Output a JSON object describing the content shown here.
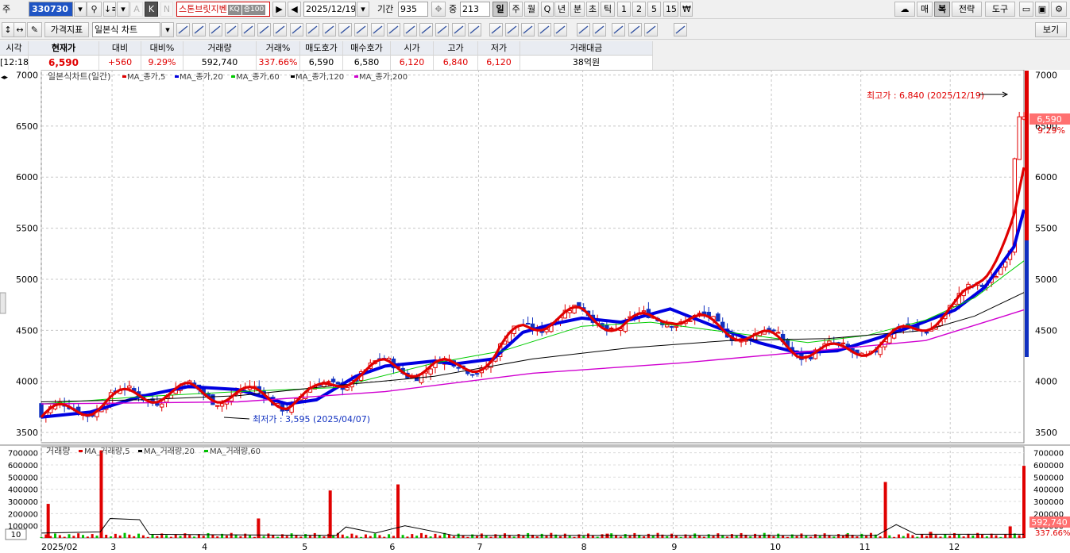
{
  "toolbar1": {
    "market": "주",
    "code": "330730",
    "name": "스톤브릿지벤",
    "name_tags": [
      "KQ",
      "증100"
    ],
    "k_button": "K",
    "n_button": "N",
    "date": "2025/12/19",
    "period_label": "기간",
    "period_value": "935",
    "mid_label": "중",
    "mid_value": "213",
    "timeframes": [
      "일",
      "주",
      "월",
      "Q",
      "년",
      "분",
      "초",
      "틱",
      "1",
      "2",
      "5",
      "15",
      "₩"
    ],
    "active_timeframe": "일",
    "right_buttons": [
      "매",
      "복",
      "전략",
      "도구"
    ]
  },
  "toolbar2": {
    "indicator_button": "가격지표",
    "chart_type": "일본식 차트",
    "view_button": "보기"
  },
  "quote": {
    "headers": [
      "시각",
      "현재가",
      "대비",
      "대비%",
      "거래량",
      "거래%",
      "매도호가",
      "매수호가",
      "시가",
      "고가",
      "저가",
      "거래대금"
    ],
    "values": [
      "[12:18]",
      "6,590",
      "+560",
      "9.29%",
      "592,740",
      "337.66%",
      "6,590",
      "6,580",
      "6,120",
      "6,840",
      "6,120",
      "38억원"
    ]
  },
  "colors": {
    "up": "#e00000",
    "ma5": "#e00000",
    "ma20": "#0000e0",
    "ma60": "#00cc00",
    "ma120": "#000000",
    "ma200": "#d000d0"
  },
  "price_legend": "일본식차트(일간)",
  "price_ma_labels": [
    "MA_종가,5",
    "MA_종가,20",
    "MA_종가,60",
    "MA_종가,120",
    "MA_종가,200"
  ],
  "volume_legend": "거래량",
  "volume_ma_labels": [
    "MA_거래량,5",
    "MA_거래량,20",
    "MA_거래량,60"
  ],
  "annotations": {
    "high": "최고가 : 6,840 (2025/12/19)",
    "low": "최저가 : 3,595 (2025/04/07)"
  },
  "current_price_tag": "6,590",
  "current_change_tag": "9.29%",
  "current_volume_tag": "592,740",
  "current_volume_pct_tag": "337.66%",
  "volume_scale_box": "10",
  "chart_data": [
    {
      "type": "candlestick",
      "title": "일본식차트(일간)",
      "ylim": [
        3400,
        7050
      ],
      "yticks": [
        3500,
        4000,
        4500,
        5000,
        5500,
        6000,
        6500,
        7000
      ],
      "x_months": [
        "2025/02",
        "3",
        "4",
        "5",
        "6",
        "7",
        "8",
        "9",
        "10",
        "11",
        "12"
      ],
      "ma": [
        {
          "name": "MA_종가,20",
          "points": [
            [
              0,
              3650
            ],
            [
              0.05,
              3700
            ],
            [
              0.1,
              3850
            ],
            [
              0.15,
              3950
            ],
            [
              0.2,
              3920
            ],
            [
              0.25,
              3780
            ],
            [
              0.28,
              3820
            ],
            [
              0.32,
              4050
            ],
            [
              0.35,
              4150
            ],
            [
              0.4,
              4200
            ],
            [
              0.42,
              4170
            ],
            [
              0.46,
              4220
            ],
            [
              0.49,
              4480
            ],
            [
              0.52,
              4560
            ],
            [
              0.55,
              4620
            ],
            [
              0.59,
              4580
            ],
            [
              0.64,
              4710
            ],
            [
              0.69,
              4520
            ],
            [
              0.73,
              4380
            ],
            [
              0.77,
              4280
            ],
            [
              0.81,
              4300
            ],
            [
              0.85,
              4420
            ],
            [
              0.89,
              4550
            ],
            [
              0.93,
              4700
            ],
            [
              0.96,
              4920
            ],
            [
              0.99,
              5320
            ],
            [
              1,
              5680
            ]
          ]
        },
        {
          "name": "MA_종가,60",
          "points": [
            [
              0,
              3780
            ],
            [
              0.1,
              3850
            ],
            [
              0.2,
              3900
            ],
            [
              0.3,
              3940
            ],
            [
              0.4,
              4180
            ],
            [
              0.47,
              4300
            ],
            [
              0.55,
              4540
            ],
            [
              0.62,
              4580
            ],
            [
              0.7,
              4480
            ],
            [
              0.78,
              4380
            ],
            [
              0.84,
              4450
            ],
            [
              0.9,
              4600
            ],
            [
              0.95,
              4820
            ],
            [
              1,
              5180
            ]
          ]
        },
        {
          "name": "MA_종가,120",
          "points": [
            [
              0,
              3800
            ],
            [
              0.1,
              3820
            ],
            [
              0.2,
              3860
            ],
            [
              0.3,
              3960
            ],
            [
              0.4,
              4050
            ],
            [
              0.5,
              4220
            ],
            [
              0.6,
              4330
            ],
            [
              0.7,
              4400
            ],
            [
              0.8,
              4420
            ],
            [
              0.9,
              4500
            ],
            [
              0.95,
              4640
            ],
            [
              1,
              4870
            ]
          ]
        },
        {
          "name": "MA_종가,200",
          "points": [
            [
              0,
              3780
            ],
            [
              0.2,
              3800
            ],
            [
              0.35,
              3900
            ],
            [
              0.5,
              4080
            ],
            [
              0.65,
              4180
            ],
            [
              0.8,
              4310
            ],
            [
              0.9,
              4400
            ],
            [
              1,
              4700
            ]
          ]
        }
      ]
    },
    {
      "type": "bar",
      "title": "거래량",
      "ylim": [
        0,
        750000
      ],
      "yticks": [
        100000,
        200000,
        300000,
        400000,
        500000,
        600000,
        700000
      ],
      "spikes": [
        [
          0.007,
          280000
        ],
        [
          0.061,
          720000
        ],
        [
          0.221,
          160000
        ],
        [
          0.294,
          390000
        ],
        [
          0.363,
          440000
        ],
        [
          0.576,
          35000
        ],
        [
          0.82,
          30000
        ],
        [
          0.859,
          460000
        ],
        [
          0.905,
          50000
        ],
        [
          0.953,
          25000
        ],
        [
          0.986,
          95000
        ],
        [
          1,
          592740
        ]
      ]
    }
  ]
}
